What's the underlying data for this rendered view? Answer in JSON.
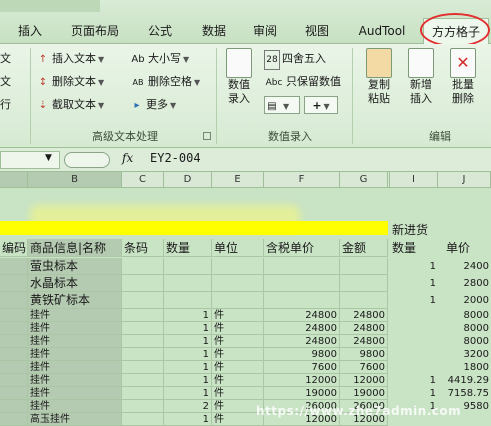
{
  "tabs": [
    {
      "label": "插入"
    },
    {
      "label": "页面布局"
    },
    {
      "label": "公式"
    },
    {
      "label": "数据"
    },
    {
      "label": "审阅"
    },
    {
      "label": "视图"
    },
    {
      "label": "AudTool"
    },
    {
      "label": "方方格子"
    }
  ],
  "ribbon": {
    "left_partial": [
      "文",
      "文",
      "行"
    ],
    "text_group": {
      "col1": [
        "插入文本",
        "删除文本",
        "截取文本"
      ],
      "col2": [
        "大小写",
        "删除空格",
        "更多"
      ],
      "col2_icons": [
        "Ab",
        "AB"
      ],
      "label": "高级文本处理"
    },
    "numeric_group": {
      "big_button": {
        "line1": "数值",
        "line2": "录入"
      },
      "small": [
        "四舍五入",
        "只保留数值"
      ],
      "small_icons": [
        "28",
        "Abc"
      ],
      "plus": "+",
      "label": "数值录入"
    },
    "edit_group": {
      "buttons": [
        {
          "line1": "复制",
          "line2": "粘贴"
        },
        {
          "line1": "新增",
          "line2": "插入"
        },
        {
          "line1": "批量",
          "line2": "删除"
        }
      ],
      "label": "编辑"
    }
  },
  "formula_bar": {
    "fx": "fx",
    "content": "EY2-004"
  },
  "columns": [
    "B",
    "C",
    "D",
    "E",
    "F",
    "G",
    "I",
    "J"
  ],
  "header_row": {
    "a": "编码",
    "b": "商品信息|名称",
    "c": "条码",
    "d": "数量",
    "e": "单位",
    "f": "含税单价",
    "g": "金额",
    "i": "数量",
    "j": "单价"
  },
  "above_header": {
    "i": "新进货"
  },
  "category_rows": [
    {
      "b": "萤虫标本",
      "i": "1",
      "j": "2400"
    },
    {
      "b": "水晶标本",
      "i": "1",
      "j": "2800"
    },
    {
      "b": "黄铁矿标本",
      "i": "1",
      "j": "2000"
    }
  ],
  "data_rows": [
    {
      "b": "挂件",
      "d": "1",
      "e": "件",
      "f": "24800",
      "g": "24800",
      "i": "",
      "j": "8000"
    },
    {
      "b": "挂件",
      "d": "1",
      "e": "件",
      "f": "24800",
      "g": "24800",
      "i": "",
      "j": "8000"
    },
    {
      "b": "挂件",
      "d": "1",
      "e": "件",
      "f": "24800",
      "g": "24800",
      "i": "",
      "j": "8000"
    },
    {
      "b": "挂件",
      "d": "1",
      "e": "件",
      "f": "9800",
      "g": "9800",
      "i": "",
      "j": "3200"
    },
    {
      "b": "挂件",
      "d": "1",
      "e": "件",
      "f": "7600",
      "g": "7600",
      "i": "",
      "j": "1800"
    },
    {
      "b": "挂件",
      "d": "1",
      "e": "件",
      "f": "12000",
      "g": "12000",
      "i": "1",
      "j": "4419.29"
    },
    {
      "b": "挂件",
      "d": "1",
      "e": "件",
      "f": "19000",
      "g": "19000",
      "i": "1",
      "j": "7158.75"
    },
    {
      "b": "挂件",
      "d": "2",
      "e": "件",
      "f": "26000",
      "g": "26000",
      "i": "1",
      "j": "9580"
    },
    {
      "b": "高玉挂件",
      "d": "1",
      "e": "件",
      "f": "12000",
      "g": "12000",
      "i": "",
      "j": ""
    }
  ],
  "watermark": "https://www.zhe7admin.com"
}
